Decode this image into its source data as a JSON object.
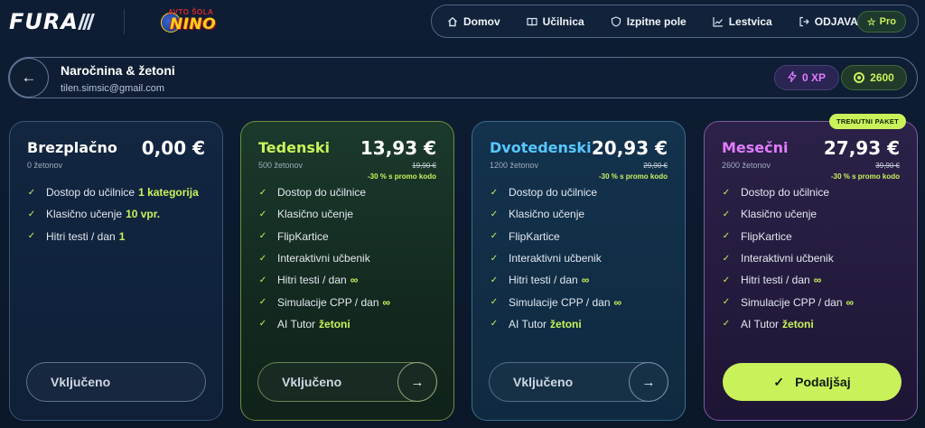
{
  "brand": {
    "logo_text": "FURA",
    "school_top": "AVTO ŠOLA",
    "school_name": "NINO"
  },
  "nav": {
    "items": [
      {
        "label": "Domov",
        "icon": "home-icon"
      },
      {
        "label": "Učilnica",
        "icon": "book-icon"
      },
      {
        "label": "Izpitne pole",
        "icon": "shield-icon"
      },
      {
        "label": "Lestvica",
        "icon": "chart-icon"
      },
      {
        "label": "ODJAVA",
        "icon": "logout-icon"
      }
    ],
    "pro_label": "Pro"
  },
  "header": {
    "title": "Naročnina & žetoni",
    "email": "tilen.simsic@gmail.com",
    "xp": "0 XP",
    "coins": "2600"
  },
  "plans": [
    {
      "name": "Brezplačno",
      "price": "0,00 €",
      "tokens": "0 žetonov",
      "features": [
        {
          "text": "Dostop do učilnice",
          "highlight": "1 kategorija"
        },
        {
          "text": "Klasično učenje",
          "highlight": "10 vpr."
        },
        {
          "text": "Hitri testi / dan",
          "highlight": "1"
        }
      ],
      "button": "Vključeno"
    },
    {
      "name": "Tedenski",
      "price": "13,93 €",
      "tokens": "500 žetonov",
      "old_price": "19,90 €",
      "promo": "-30 % s promo kodo",
      "features": [
        {
          "text": "Dostop do učilnice",
          "highlight": ""
        },
        {
          "text": "Klasično učenje",
          "highlight": ""
        },
        {
          "text": "FlipKartice",
          "highlight": ""
        },
        {
          "text": "Interaktivni učbenik",
          "highlight": ""
        },
        {
          "text": "Hitri testi / dan",
          "highlight": "∞"
        },
        {
          "text": "Simulacije CPP / dan",
          "highlight": "∞"
        },
        {
          "text": "AI Tutor",
          "highlight": "žetoni"
        }
      ],
      "button": "Vključeno"
    },
    {
      "name": "Dvotedenski",
      "price": "20,93 €",
      "tokens": "1200 žetonov",
      "old_price": "29,90 €",
      "promo": "-30 % s promo kodo",
      "features": [
        {
          "text": "Dostop do učilnice",
          "highlight": ""
        },
        {
          "text": "Klasično učenje",
          "highlight": ""
        },
        {
          "text": "FlipKartice",
          "highlight": ""
        },
        {
          "text": "Interaktivni učbenik",
          "highlight": ""
        },
        {
          "text": "Hitri testi / dan",
          "highlight": "∞"
        },
        {
          "text": "Simulacije CPP / dan",
          "highlight": "∞"
        },
        {
          "text": "AI Tutor",
          "highlight": "žetoni"
        }
      ],
      "button": "Vključeno"
    },
    {
      "name": "Mesečni",
      "price": "27,93 €",
      "tokens": "2600 žetonov",
      "old_price": "39,90 €",
      "promo": "-30 % s promo kodo",
      "tag": "TRENUTNI PAKET",
      "features": [
        {
          "text": "Dostop do učilnice",
          "highlight": ""
        },
        {
          "text": "Klasično učenje",
          "highlight": ""
        },
        {
          "text": "FlipKartice",
          "highlight": ""
        },
        {
          "text": "Interaktivni učbenik",
          "highlight": ""
        },
        {
          "text": "Hitri testi / dan",
          "highlight": "∞"
        },
        {
          "text": "Simulacije CPP / dan",
          "highlight": "∞"
        },
        {
          "text": "AI Tutor",
          "highlight": "žetoni"
        }
      ],
      "button": "Podaljšaj"
    }
  ],
  "colors": {
    "accent": "#c9f25a",
    "xp": "#e07cff",
    "blue": "#57c8ff",
    "background": "#0e1d34"
  }
}
